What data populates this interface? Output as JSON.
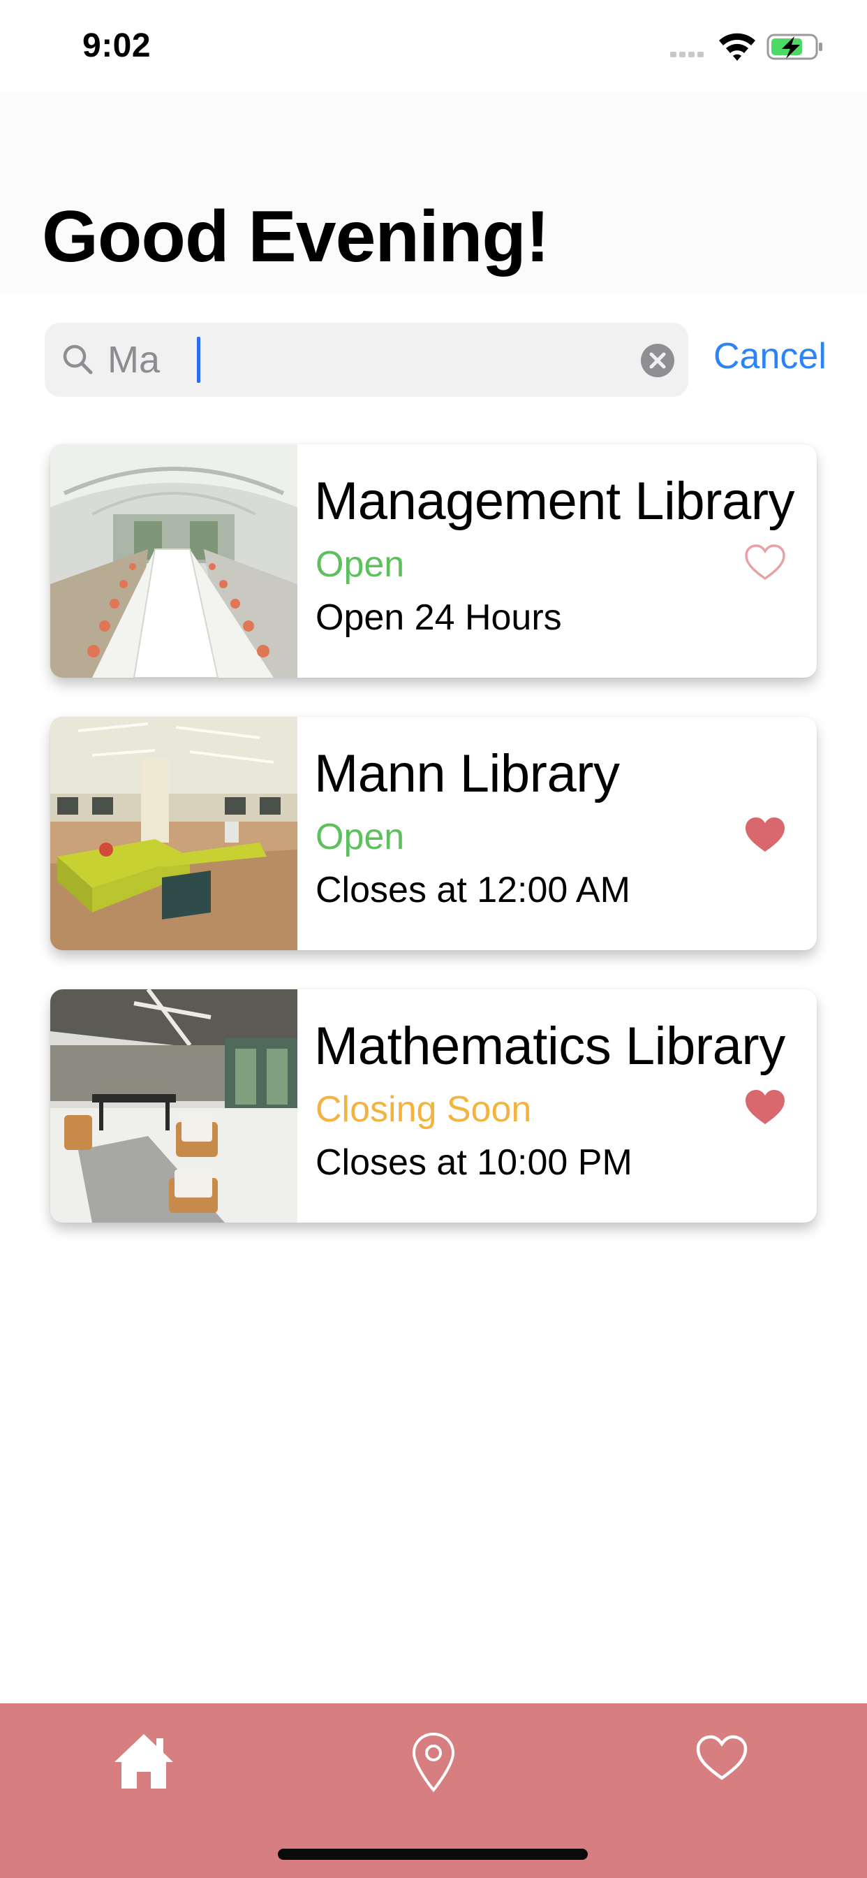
{
  "status_bar": {
    "time": "9:02",
    "icons": [
      "signal-icon",
      "wifi-icon",
      "battery-charging-icon"
    ]
  },
  "header": {
    "greeting": "Good Evening!"
  },
  "search": {
    "value": "Ma",
    "cancel_label": "Cancel"
  },
  "libraries": [
    {
      "name": "Management Library",
      "status": "Open",
      "status_color": "#5cc05c",
      "hours": "Open 24 Hours",
      "favorited": false
    },
    {
      "name": "Mann Library",
      "status": "Open",
      "status_color": "#5cc05c",
      "hours": "Closes at 12:00 AM",
      "favorited": true
    },
    {
      "name": "Mathematics Library",
      "status": "Closing Soon",
      "status_color": "#f4b33f",
      "hours": "Closes at 10:00 PM",
      "favorited": true
    }
  ],
  "tab_bar": {
    "background": "#d77e80",
    "tabs": [
      "home-icon",
      "map-pin-icon",
      "heart-icon"
    ]
  },
  "colors": {
    "accent": "#2b84f7",
    "favorite": "#d9686e"
  }
}
